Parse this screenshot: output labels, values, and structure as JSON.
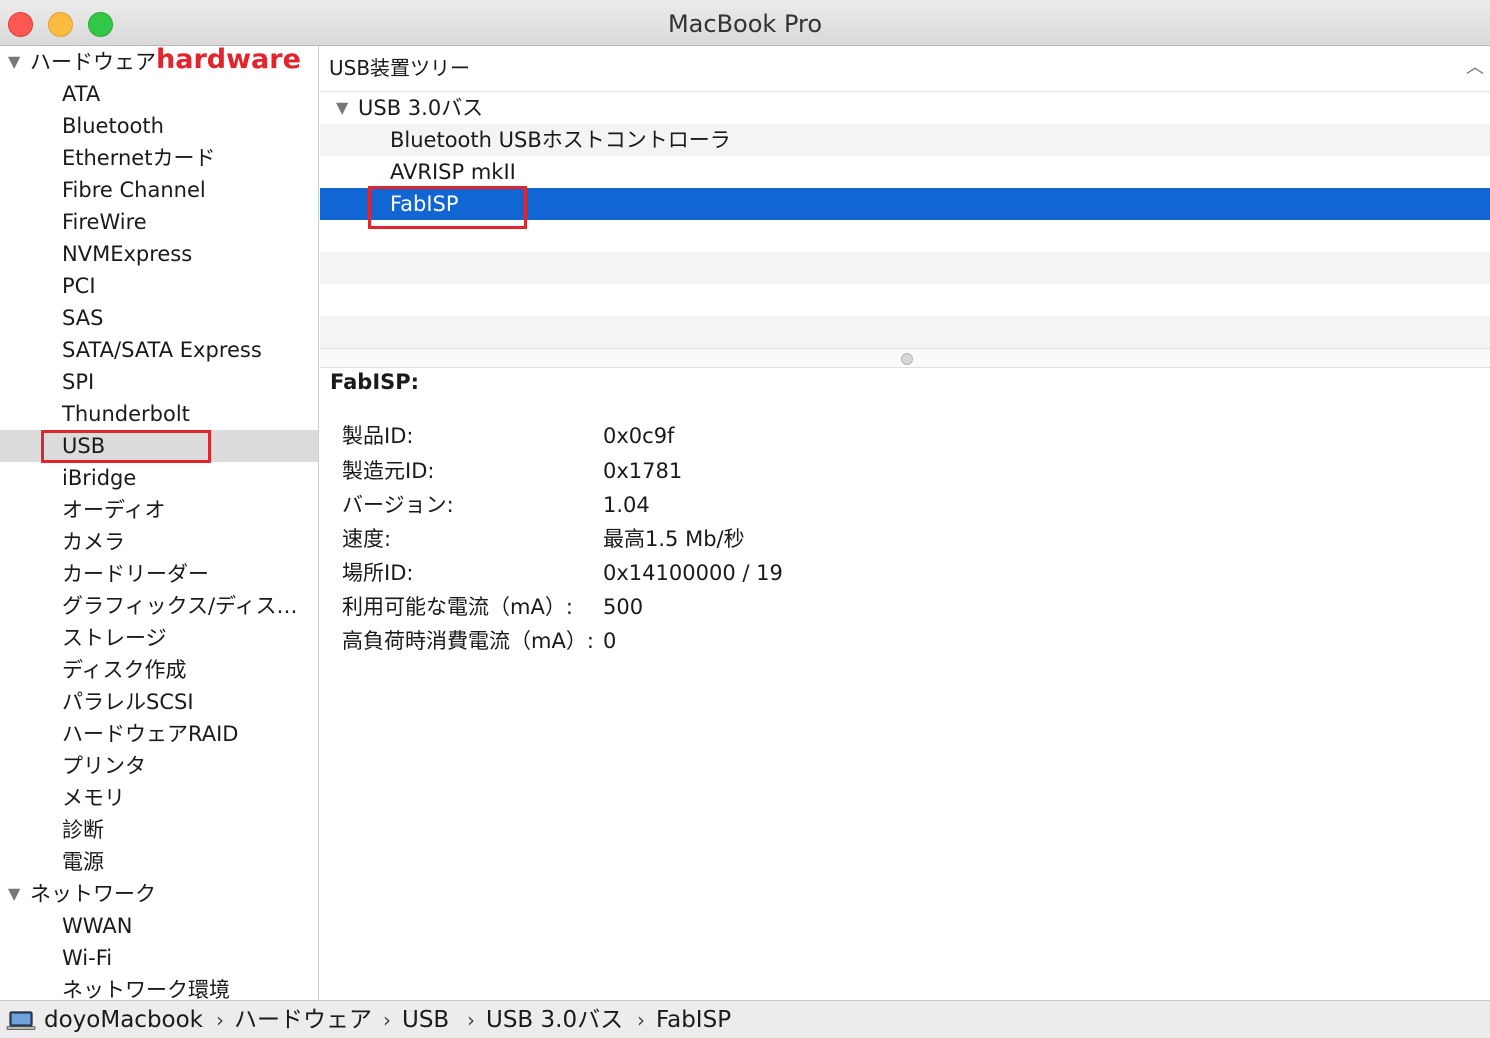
{
  "window": {
    "title": "MacBook Pro"
  },
  "sidebar": {
    "hardware_group": {
      "label": "ハードウェア",
      "annotation": "hardware",
      "items": [
        "ATA",
        "Bluetooth",
        "Ethernetカード",
        "Fibre Channel",
        "FireWire",
        "NVMExpress",
        "PCI",
        "SAS",
        "SATA/SATA Express",
        "SPI",
        "Thunderbolt",
        "USB",
        "iBridge",
        "オーディオ",
        "カメラ",
        "カードリーダー",
        "グラフィックス/ディス…",
        "ストレージ",
        "ディスク作成",
        "パラレルSCSI",
        "ハードウェアRAID",
        "プリンタ",
        "メモリ",
        "診断",
        "電源"
      ],
      "selected": "USB"
    },
    "network_group": {
      "label": "ネットワーク",
      "items": [
        "WWAN",
        "Wi-Fi",
        "ネットワーク環境"
      ]
    }
  },
  "tree": {
    "header": "USB装置ツリー",
    "bus": "USB 3.0バス",
    "devices": [
      "Bluetooth USBホストコントローラ",
      "AVRISP mkII",
      "FabISP"
    ],
    "selected": "FabISP"
  },
  "detail": {
    "title": "FabISP:",
    "properties": [
      {
        "key": "製品ID:",
        "value": "0x0c9f"
      },
      {
        "key": "製造元ID:",
        "value": "0x1781"
      },
      {
        "key": "バージョン:",
        "value": "1.04"
      },
      {
        "key": "速度:",
        "value": "最高1.5 Mb/秒"
      },
      {
        "key": "場所ID:",
        "value": "0x14100000 / 19"
      },
      {
        "key": "利用可能な電流（mA）:",
        "value": "500"
      },
      {
        "key": "高負荷時消費電流（mA）:",
        "value": "0"
      }
    ]
  },
  "pathbar": {
    "icon": "laptop-icon",
    "crumbs": [
      "doyoMacbook",
      "ハードウェア",
      "USB",
      "USB 3.0バス",
      "FabISP"
    ],
    "separator": "›"
  },
  "colors": {
    "selection_blue": "#1166d4",
    "annotation_red": "#e0252c",
    "sidebar_selected": "#dcdcdc"
  }
}
